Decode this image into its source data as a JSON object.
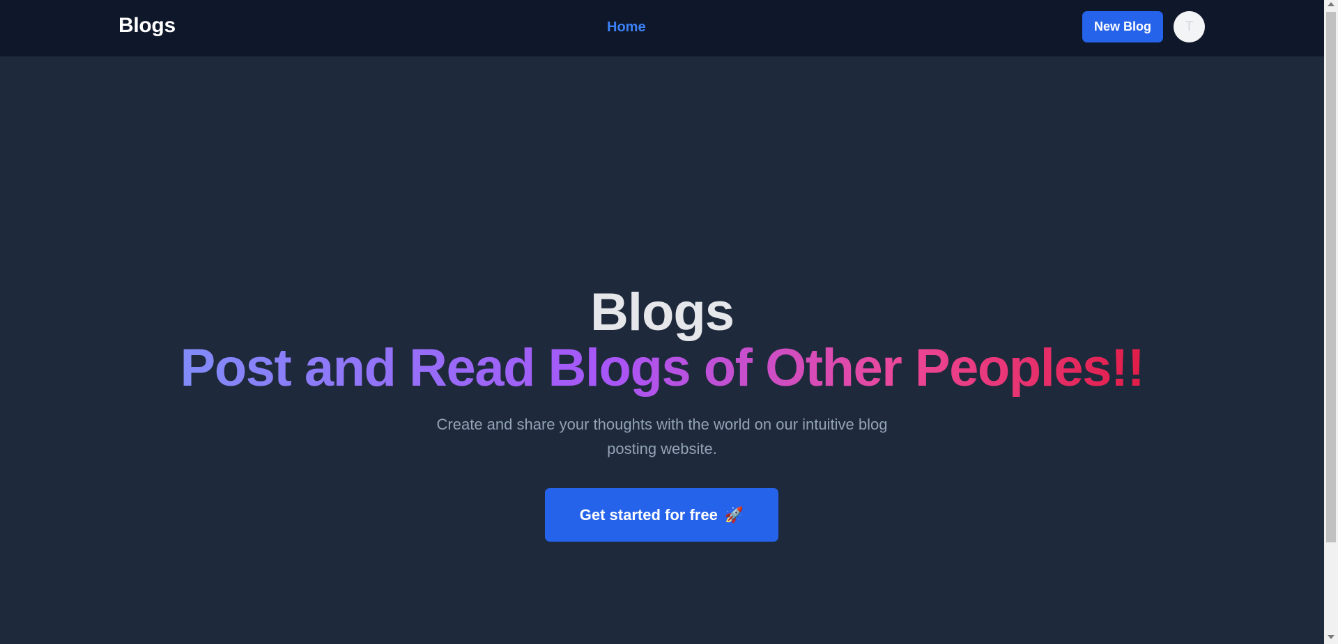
{
  "navbar": {
    "brand": "Blogs",
    "home_link": "Home",
    "new_blog_button": "New Blog",
    "avatar_initial": "T"
  },
  "hero": {
    "title": "Blogs",
    "tagline": "Post and Read Blogs of Other Peoples!!",
    "description": "Create and share your thoughts with the world on our intuitive blog posting website.",
    "cta_label": "Get started for free",
    "cta_icon": "🚀"
  },
  "colors": {
    "navbar_bg": "#0f172a",
    "page_bg": "#1e293b",
    "accent": "#2563eb",
    "link": "#3b82f6",
    "gradient": [
      "#818cf8",
      "#a855f7",
      "#ec4899",
      "#e11d48"
    ]
  }
}
